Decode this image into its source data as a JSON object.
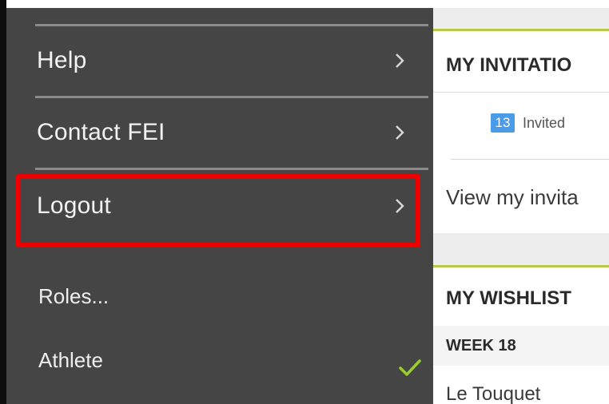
{
  "menu": {
    "items": [
      {
        "label": "Help"
      },
      {
        "label": "Contact FEI"
      },
      {
        "label": "Logout"
      }
    ],
    "roles_label": "Roles...",
    "roles": [
      {
        "label": "Athlete",
        "selected": true
      }
    ]
  },
  "content": {
    "invitations": {
      "title": "MY INVITATIO",
      "invited_count": "13",
      "invited_label": "Invited",
      "view_link": "View my invita"
    },
    "wishlist": {
      "title": "MY WISHLIST",
      "week_label": "WEEK 18",
      "event": "Le Touquet"
    }
  },
  "colors": {
    "menu_background": "#454545",
    "highlight": "#ee0000",
    "accent_green": "#b7c94a",
    "badge_blue": "#4a9be8",
    "check_green": "#9acd32"
  }
}
